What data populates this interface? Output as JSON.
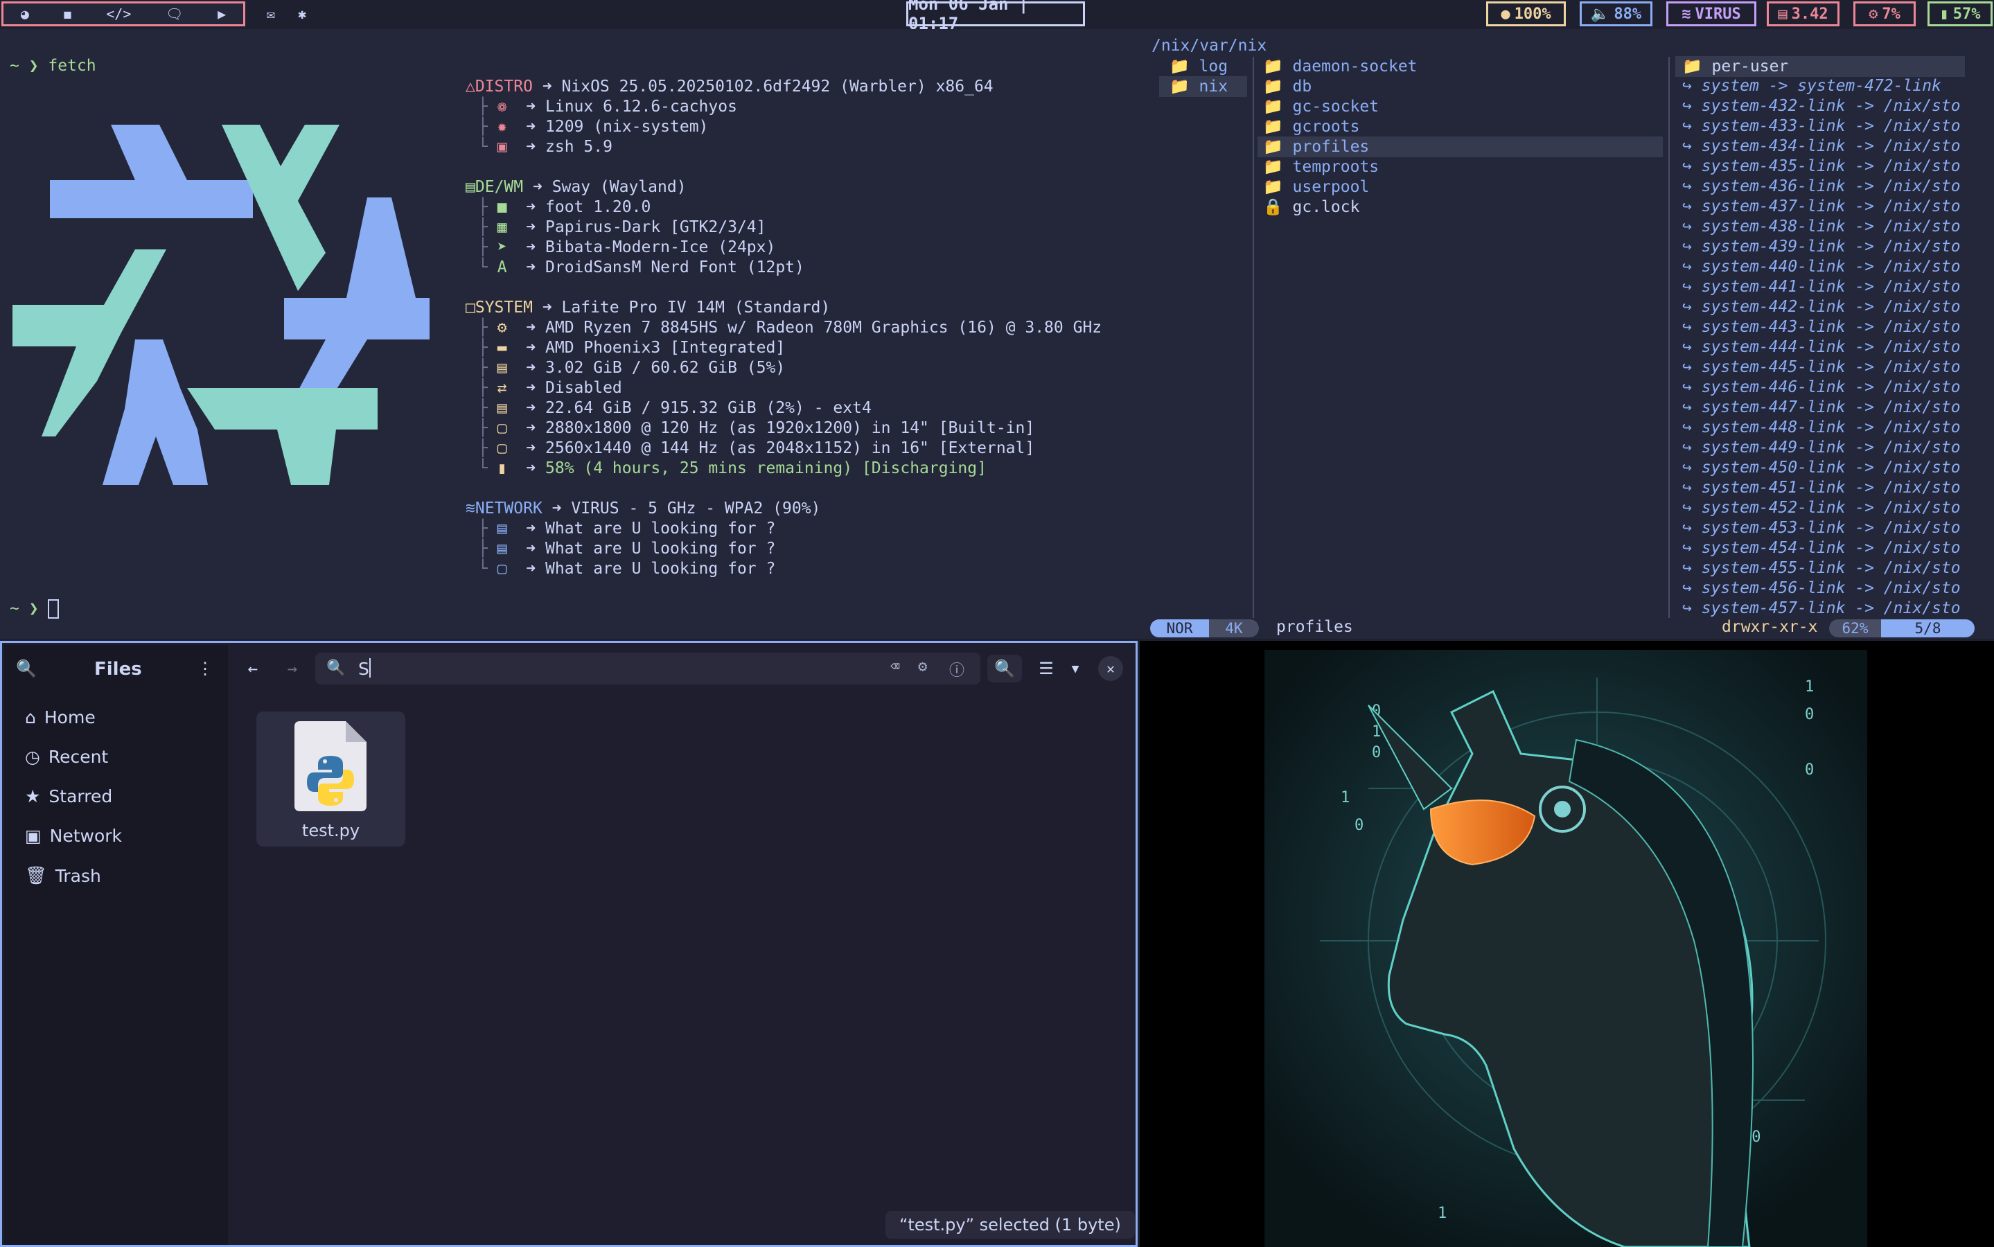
{
  "bar": {
    "clock": "Mon  06  Jan | 01:17",
    "volume": "88%",
    "brightness": "100%",
    "network": "VIRUS",
    "mem": "3.42",
    "cpu": "7%",
    "battery": "57%",
    "colors": {
      "pink": "#ed8796",
      "blue": "#8aadf4",
      "purple": "#c6a0f6",
      "yellow": "#eed49f",
      "green": "#a6da95"
    }
  },
  "terminal": {
    "prompt_symbol": "~ ❯",
    "command": "fetch",
    "distro": {
      "label": "DISTRO",
      "value": "NixOS 25.05.20250102.6df2492 (Warbler) x86_64",
      "items": [
        "Linux 6.12.6-cachyos",
        "1209 (nix-system)",
        "zsh 5.9"
      ]
    },
    "dewm": {
      "label": "DE/WM",
      "value": "Sway (Wayland)",
      "items": [
        "foot 1.20.0",
        "Papirus-Dark [GTK2/3/4]",
        "Bibata-Modern-Ice (24px)",
        "DroidSansM Nerd Font (12pt)"
      ]
    },
    "system": {
      "label": "SYSTEM",
      "value": "Lafite Pro IV 14M (Standard)",
      "items": [
        "AMD Ryzen 7 8845HS w/ Radeon 780M Graphics (16) @ 3.80 GHz",
        "AMD Phoenix3 [Integrated]",
        "3.02 GiB / 60.62 GiB (5%)",
        "Disabled",
        "22.64 GiB / 915.32 GiB (2%) - ext4",
        "2880x1800 @ 120 Hz (as 1920x1200) in 14\" [Built-in]",
        "2560x1440 @ 144 Hz (as 2048x1152) in 16\" [External]",
        "58% (4 hours, 25 mins remaining) [Discharging]"
      ]
    },
    "network": {
      "label": "NETWORK",
      "value": "VIRUS - 5 GHz - WPA2 (90%)",
      "items": [
        "What are U looking for ?",
        "What are U looking for ?",
        "What are U looking for ?"
      ]
    }
  },
  "yazi": {
    "path": "/nix/var/nix",
    "parent": [
      "log",
      "nix"
    ],
    "current": [
      "daemon-socket",
      "db",
      "gc-socket",
      "gcroots",
      "profiles",
      "temproots",
      "userpool",
      "gc.lock"
    ],
    "preview": [
      "per-user",
      "system -> system-472-link",
      "system-432-link -> /nix/sto",
      "system-433-link -> /nix/sto",
      "system-434-link -> /nix/sto",
      "system-435-link -> /nix/sto",
      "system-436-link -> /nix/sto",
      "system-437-link -> /nix/sto",
      "system-438-link -> /nix/sto",
      "system-439-link -> /nix/sto",
      "system-440-link -> /nix/sto",
      "system-441-link -> /nix/sto",
      "system-442-link -> /nix/sto",
      "system-443-link -> /nix/sto",
      "system-444-link -> /nix/sto",
      "system-445-link -> /nix/sto",
      "system-446-link -> /nix/sto",
      "system-447-link -> /nix/sto",
      "system-448-link -> /nix/sto",
      "system-449-link -> /nix/sto",
      "system-450-link -> /nix/sto",
      "system-451-link -> /nix/sto",
      "system-452-link -> /nix/sto",
      "system-453-link -> /nix/sto",
      "system-454-link -> /nix/sto",
      "system-455-link -> /nix/sto",
      "system-456-link -> /nix/sto",
      "system-457-link -> /nix/sto"
    ],
    "status": {
      "mode": "NOR",
      "size": "4K",
      "name": "profiles",
      "perms": "drwxr-xr-x",
      "percent": "62%",
      "pos": "5/8"
    }
  },
  "files": {
    "title": "Files",
    "sidebar": [
      "Home",
      "Recent",
      "Starred",
      "Network",
      "Trash"
    ],
    "search_value": "S",
    "file_name": "test.py",
    "status": "“test.py” selected (1 byte)"
  }
}
